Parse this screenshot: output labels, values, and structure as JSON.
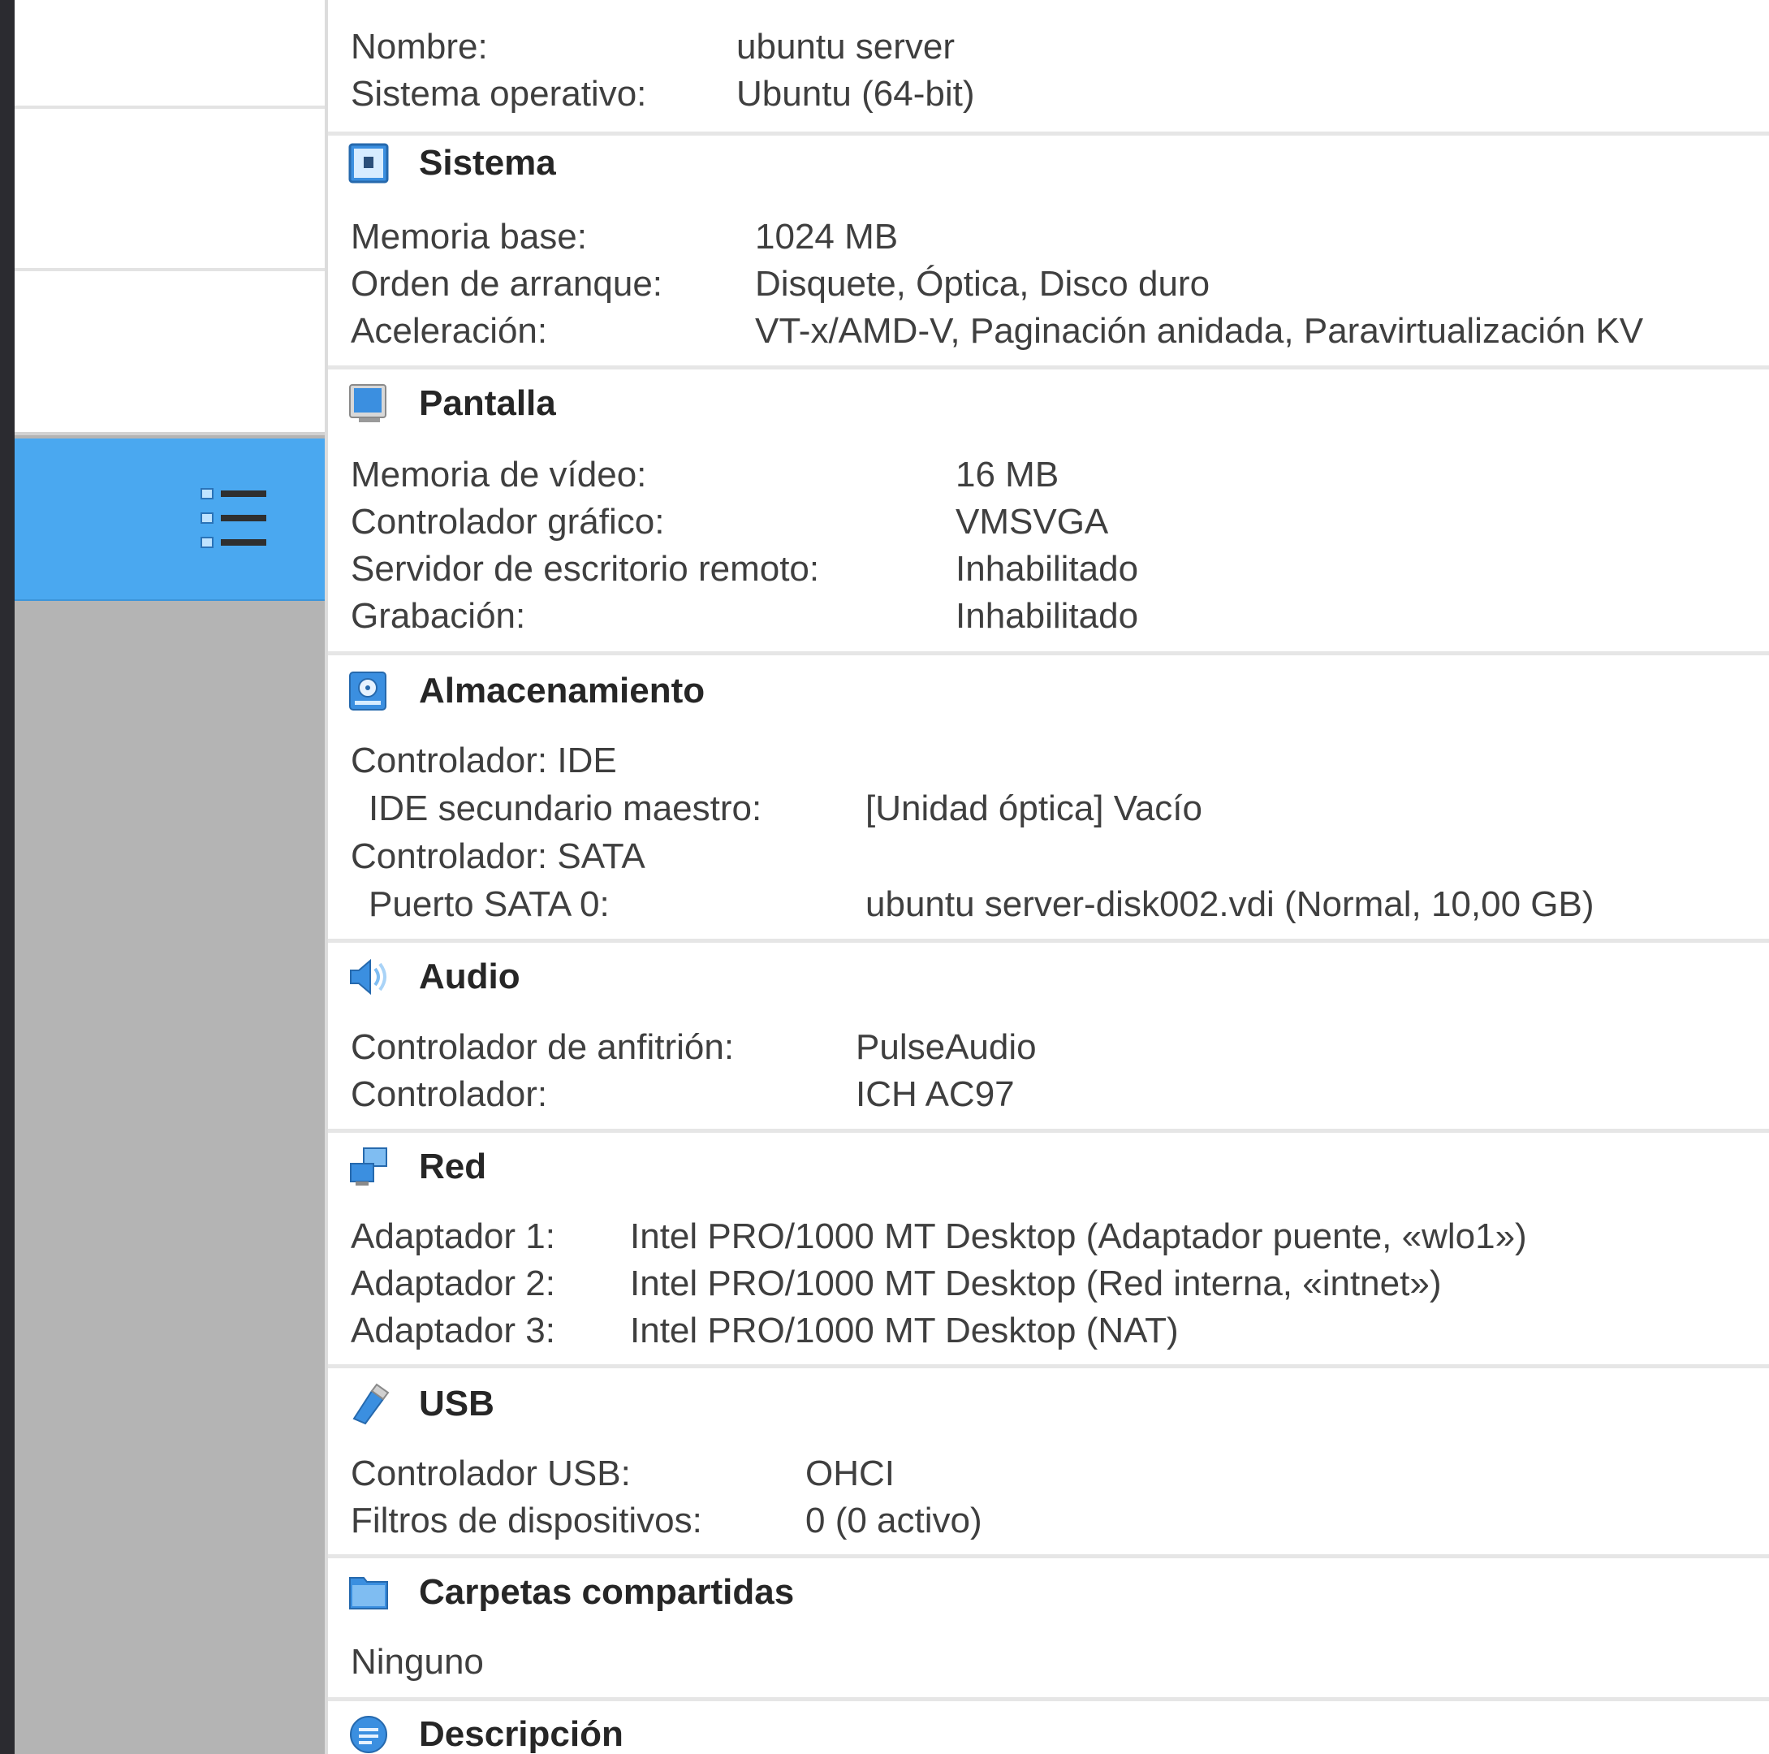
{
  "general": {
    "rows": [
      {
        "label": "Nombre:",
        "value": "ubuntu server"
      },
      {
        "label": "Sistema operativo:",
        "value": "Ubuntu (64-bit)"
      }
    ]
  },
  "sections": {
    "sistema": {
      "title": "Sistema",
      "rows": [
        {
          "label": "Memoria base:",
          "value": "1024 MB"
        },
        {
          "label": "Orden de arranque:",
          "value": "Disquete, Óptica, Disco duro"
        },
        {
          "label": "Aceleración:",
          "value": "VT-x/AMD-V, Paginación anidada, Paravirtualización KV"
        }
      ]
    },
    "pantalla": {
      "title": "Pantalla",
      "rows": [
        {
          "label": "Memoria de vídeo:",
          "value": "16 MB"
        },
        {
          "label": "Controlador gráfico:",
          "value": "VMSVGA"
        },
        {
          "label": "Servidor de escritorio remoto:",
          "value": "Inhabilitado"
        },
        {
          "label": "Grabación:",
          "value": "Inhabilitado"
        }
      ]
    },
    "almacenamiento": {
      "title": "Almacenamiento",
      "rows": [
        {
          "label": "Controlador: IDE",
          "value": ""
        },
        {
          "label": "IDE secundario maestro:",
          "value": "[Unidad óptica] Vacío"
        },
        {
          "label": "Controlador: SATA",
          "value": ""
        },
        {
          "label": "Puerto SATA 0:",
          "value": "ubuntu server-disk002.vdi (Normal, 10,00 GB)"
        }
      ]
    },
    "audio": {
      "title": "Audio",
      "rows": [
        {
          "label": "Controlador de anfitrión:",
          "value": "PulseAudio"
        },
        {
          "label": "Controlador:",
          "value": "ICH AC97"
        }
      ]
    },
    "red": {
      "title": "Red",
      "rows": [
        {
          "label": "Adaptador 1:",
          "value": "Intel PRO/1000 MT Desktop (Adaptador puente, «wlo1»)"
        },
        {
          "label": "Adaptador 2:",
          "value": "Intel PRO/1000 MT Desktop (Red interna, «intnet»)"
        },
        {
          "label": "Adaptador 3:",
          "value": "Intel PRO/1000 MT Desktop (NAT)"
        }
      ]
    },
    "usb": {
      "title": "USB",
      "rows": [
        {
          "label": "Controlador USB:",
          "value": "OHCI"
        },
        {
          "label": "Filtros de dispositivos:",
          "value": "0 (0 activo)"
        }
      ]
    },
    "carpetas": {
      "title": "Carpetas compartidas",
      "rows": [
        {
          "label": "Ninguno",
          "value": ""
        }
      ]
    },
    "descripcion": {
      "title": "Descripción"
    }
  },
  "icons": {
    "tools": "tools-list-icon",
    "sistema": "chip-icon",
    "pantalla": "monitor-icon",
    "almacenamiento": "storage-icon",
    "audio": "speaker-icon",
    "red": "network-icon",
    "usb": "usb-icon",
    "carpetas": "folder-icon",
    "descripcion": "description-icon"
  },
  "colors": {
    "selection": "#4aa8f0",
    "sidebar_bg": "#b4b4b4",
    "edge": "#2b2b30",
    "icon_blue": "#3b8fe0"
  }
}
